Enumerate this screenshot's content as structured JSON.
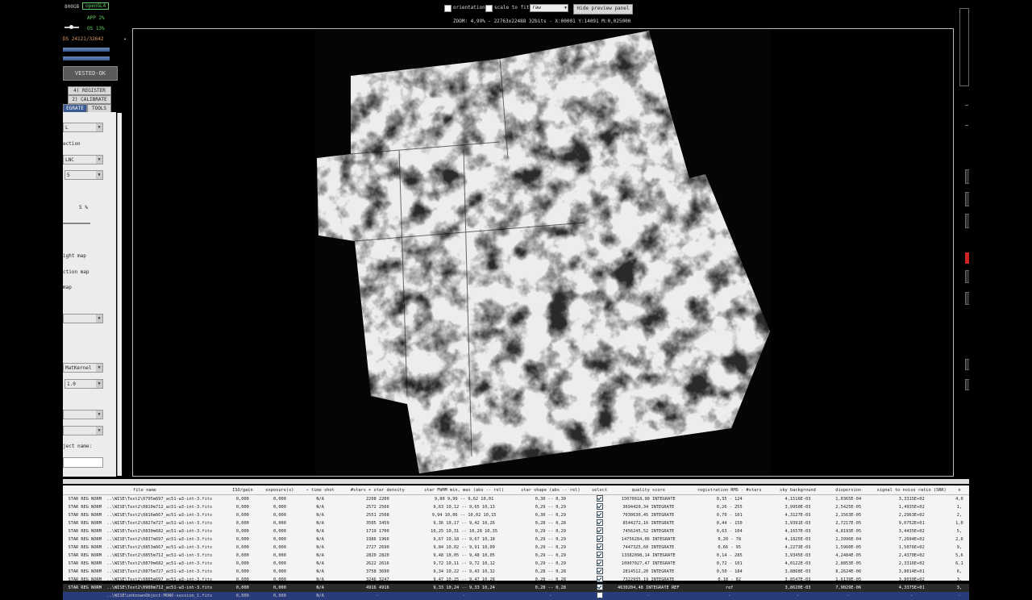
{
  "left_panel": {
    "disk": "800GB",
    "opengl": "openGL4",
    "app": "APP 2%",
    "os": "OS 13%",
    "ds": "DS 24121/32642",
    "status": "VESTED-OK",
    "register": "4) REGISTER",
    "calibrate": "2) CALIBRATE",
    "tab_integrate": "EGRATE",
    "tab_tools": "TOOLS",
    "select1": "L",
    "label_rection": "ection",
    "select2": "LNC",
    "select3": "5",
    "percent": "5  %",
    "weight_map": "ight map",
    "ction_map": "ction map",
    "map": "map",
    "kernel": "MatKernel",
    "kernel_val": "1.0",
    "object_name": "ject name:"
  },
  "top": {
    "orientation": "orientation",
    "scale_to_fit": "scale to fit",
    "mode": "raw",
    "hide_preview": "Hide preview panel",
    "zoom_info": "ZOOM: 4,99% - 22763x22488 32bits - X:00001 Y:14091 M:0,025000"
  },
  "table": {
    "columns": [
      "file name",
      "ISO/gain",
      "exposure(s)",
      "time shot",
      "#stars + star density",
      "star FWHM min, max (abs -- rel)",
      "star shape (abs -- rel)",
      "select",
      "quality score",
      "registration RMS - #stars",
      "sky background",
      "dispersion",
      "signal to noise ratio (SNR)",
      "n"
    ],
    "rows": [
      [
        "STAR REG NORM",
        "..\\WISE\\Test2\\0795m697_ac51-w3-int-3.fits",
        "0,000",
        "0,000",
        "N/A",
        "2208 2200",
        "9,80 9,99 -- 9,62 10,01",
        "0,30 -- 0,30",
        "1",
        "15070818,90 INTEGRATE",
        "0,35 - 124",
        "4,1516E-03",
        "1,0365E-04",
        "3,3315E+02",
        "4,0"
      ],
      [
        "STAR REG NORM",
        "..\\WISE\\Test2\\0810m712_ac51-w3-int-3.fits",
        "0,000",
        "0,000",
        "N/A",
        "2572 2566",
        "9,63 10,12 -- 9,65 10,13",
        "0,29 -- 0,29",
        "1",
        "3694420,34 INTEGRATE",
        "0,26 - 255",
        "3,9950E-03",
        "2,5425E-05",
        "1,4935E+02",
        "1,"
      ],
      [
        "STAR REG NORM",
        "..\\WISE\\Test2\\0816m667_ac51-w3-int-3.fits",
        "0,000",
        "0,000",
        "N/A",
        "2551 2508",
        "9,94 10,06 -- 10,02 10,15",
        "0,30 -- 0,29",
        "1",
        "7030630,45 INTEGRATE",
        "0,70 - 101",
        "4,3127E-03",
        "2,1563E-05",
        "2,2963E+02",
        "2,"
      ],
      [
        "STAR REG NORM",
        "..\\WISE\\Test2\\0827m727_ac51-w3-int-3.fits",
        "0,000",
        "0,000",
        "N/A",
        "3505 3459",
        "9,36 10,17 -- 9,42 10,26",
        "0,28 -- 0,28",
        "1",
        "8544272,16 INTEGRATE",
        "0,44 - 150",
        "3,9391E-03",
        "2,7217E-05",
        "9,0752E+01",
        "1,0"
      ],
      [
        "STAR REG NORM",
        "..\\WISE\\Test2\\0830m682_ac51-w3-int-3.fits",
        "0,000",
        "0,000",
        "N/A",
        "1719 1700",
        "10,25 10,31 -- 10,28 10,35",
        "0,29 -- 0,29",
        "1",
        "7456245,52 INTEGRATE",
        "0,63 - 104",
        "4,1657E-03",
        "4,8193E-05",
        "3,4435E+02",
        "5,"
      ],
      [
        "STAR REG NORM",
        "..\\WISE\\Test2\\0837m697_ac51-w3-int-3.fits",
        "0,000",
        "0,000",
        "N/A",
        "1986 1966",
        "9,67 10,18 -- 9,67 10,18",
        "0,29 -- 0,29",
        "1",
        "14756284,06 INTEGRATE",
        "0,20 - 78",
        "4,1825E-03",
        "1,3996E-04",
        "7,2694E+02",
        "2,6"
      ],
      [
        "STAR REG NORM",
        "..\\WISE\\Test2\\0853m667_ac51-w3-int-3.fits",
        "0,000",
        "0,000",
        "N/A",
        "2727 2690",
        "9,84 10,02 -- 9,91 10,09",
        "0,29 -- 0,29",
        "1",
        "7447325,60 INTEGRATE",
        "0,66 - 95",
        "4,2273E-03",
        "1,5960E-05",
        "1,5076E+02",
        "9,"
      ],
      [
        "STAR REG NORM",
        "..\\WISE\\Test2\\0855m712_ac51-w3-int-3.fits",
        "0,000",
        "0,000",
        "N/A",
        "2820 2820",
        "9,48 10,05 -- 9,48 10,05",
        "0,29 -- 0,29",
        "1",
        "13382098,14 INTEGRATE",
        "0,14 - 285",
        "3,9345E-03",
        "4,2484E-05",
        "2,4370E+02",
        "5,6"
      ],
      [
        "STAR REG NORM",
        "..\\WISE\\Test2\\0870m682_ac51-w3-int-3.fits",
        "0,000",
        "0,000",
        "N/A",
        "2622 2616",
        "9,72 10,11 -- 9,72 10,12",
        "0,29 -- 0,29",
        "1",
        "10907027,47 INTEGRATE",
        "0,72 - 101",
        "4,0122E-03",
        "2,8853E-05",
        "2,3316E+02",
        "6,1"
      ],
      [
        "STAR REG NORM",
        "..\\WISE\\Test2\\0875m727_ac51-w3-int-3.fits",
        "0,000",
        "0,000",
        "N/A",
        "3758 3690",
        "9,34 10,22 -- 9,43 10,32",
        "0,28 -- 0,28",
        "1",
        "2814512,20 INTEGRATE",
        "0,50 - 184",
        "3,8868E-03",
        "8,2624E-06",
        "3,8014E+01",
        "6,"
      ],
      [
        "STAR REG NORM",
        "..\\WISE\\Test2\\0885m697_ac51-w3-int-3.fits",
        "0,000",
        "0,000",
        "N/A",
        "3246 3247",
        "9,47 10,25 -- 9,47 10,28",
        "0,28 -- 0,28",
        "1",
        "7322935,19 INTEGRATE",
        "0,18 - 82",
        "3,8547E-03",
        "1,6139E-05",
        "3,8030E+02",
        "3,"
      ],
      [
        "STAR REG NORM",
        "..\\WISE\\Test2\\0900m712_ac51-w3-int-3.fits",
        "0,000",
        "0,000",
        "N/A",
        "4916 4916",
        "9,33 10,24 -- 9,33 10,24",
        "0,28 -- 0,28",
        "1",
        "4630204,48 INTEGRATE REF",
        "ref",
        "3,8620E-03",
        "7,9029E-06",
        "4,3375E+01",
        "3,"
      ],
      [
        "",
        "..\\WISE\\unknownObject-MONO-session_1.fits",
        "0,000",
        "0,000",
        "N/A",
        "-",
        "-",
        "-",
        "0",
        "-",
        "-",
        "-",
        "-",
        "-",
        "-"
      ]
    ]
  },
  "colors": {
    "accent_green": "#66cc66",
    "accent_orange": "#dd9966",
    "selected_row": "#2a2a2a",
    "last_row": "#2a3b7a"
  }
}
